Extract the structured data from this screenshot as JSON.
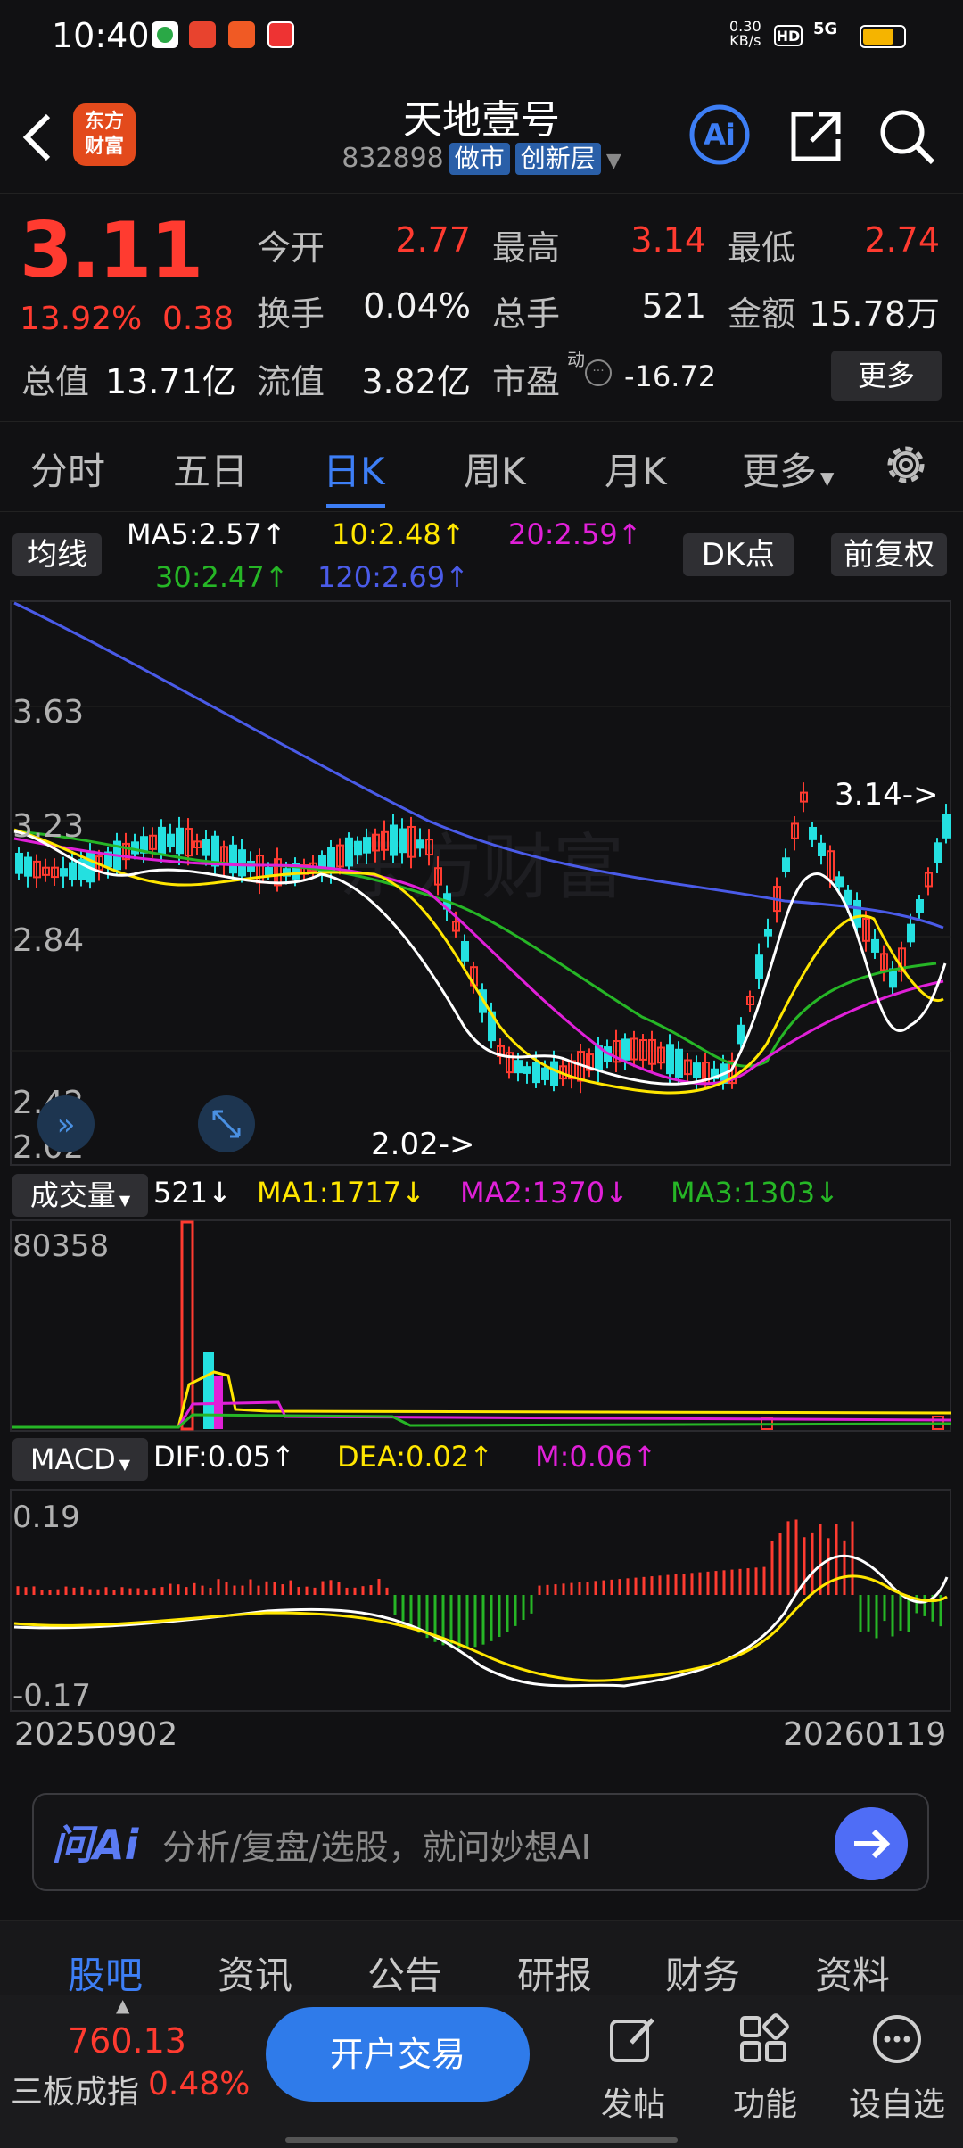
{
  "status_bar": {
    "time": "10:40",
    "net_speed": "0.30\nKB/s",
    "hd": "HD",
    "signal": "5G"
  },
  "header": {
    "stock_name": "天地壹号",
    "stock_code": "832898",
    "tags": [
      "做市",
      "创新层"
    ],
    "logo_text": "东方\n财富"
  },
  "quote": {
    "price": "3.11",
    "change_pct": "13.92%",
    "change": "0.38",
    "total_cap_label": "总值",
    "total_cap": "13.71亿",
    "fields": [
      {
        "label": "今开",
        "value": "2.77",
        "color": "red"
      },
      {
        "label": "最高",
        "value": "3.14",
        "color": "red"
      },
      {
        "label": "最低",
        "value": "2.74",
        "color": "red"
      },
      {
        "label": "换手",
        "value": "0.04%",
        "color": "white"
      },
      {
        "label": "总手",
        "value": "521",
        "color": "white"
      },
      {
        "label": "金额",
        "value": "15.78万",
        "color": "white"
      },
      {
        "label": "流值",
        "value": "3.82亿",
        "color": "white"
      },
      {
        "label": "市盈",
        "value": "-16.72",
        "color": "white"
      }
    ],
    "pe_superscript": "动",
    "more_label": "更多"
  },
  "tabs": [
    "分时",
    "五日",
    "日K",
    "周K",
    "月K",
    "更多"
  ],
  "active_tab": "日K",
  "ma_legend": {
    "button": "均线",
    "dk_button": "DK点",
    "adjust_button": "前复权",
    "items": [
      {
        "text": "MA5:2.57↑",
        "color": "#ffffff"
      },
      {
        "text": "10:2.48↑",
        "color": "#ffe600"
      },
      {
        "text": "20:2.59↑",
        "color": "#e020d8"
      },
      {
        "text": "30:2.47↑",
        "color": "#26b626"
      },
      {
        "text": "120:2.69↑",
        "color": "#4a5be8"
      }
    ]
  },
  "kline": {
    "y_labels": [
      "3.63",
      "3.23",
      "2.84",
      "2.42",
      "2.02"
    ],
    "high_marker": "3.14->",
    "low_marker": "2.02->"
  },
  "volume_legend": {
    "button": "成交量",
    "items": [
      {
        "text": "521↓",
        "color": "#ffffff"
      },
      {
        "text": "MA1:1717↓",
        "color": "#ffe600"
      },
      {
        "text": "MA2:1370↓",
        "color": "#e020d8"
      },
      {
        "text": "MA3:1303↓",
        "color": "#26b626"
      }
    ],
    "y_max": "80358"
  },
  "macd_legend": {
    "button": "MACD",
    "items": [
      {
        "text": "DIF:0.05↑",
        "color": "#ffffff"
      },
      {
        "text": "DEA:0.02↑",
        "color": "#ffe600"
      },
      {
        "text": "M:0.06↑",
        "color": "#e020d8"
      }
    ],
    "y_top": "0.19",
    "y_bottom": "-0.17"
  },
  "dates": {
    "start": "20250902",
    "end": "20260119"
  },
  "ai_bar": {
    "logo": "问Ai",
    "placeholder": "分析/复盘/选股，就问妙想AI"
  },
  "bottom_tabs": [
    "股吧",
    "资讯",
    "公告",
    "研报",
    "财务",
    "资料"
  ],
  "footer": {
    "index_value": "760.13",
    "index_name": "三板成指",
    "index_pct": "0.48%",
    "open_account": "开户交易",
    "actions": [
      "发帖",
      "功能",
      "设自选"
    ]
  }
}
